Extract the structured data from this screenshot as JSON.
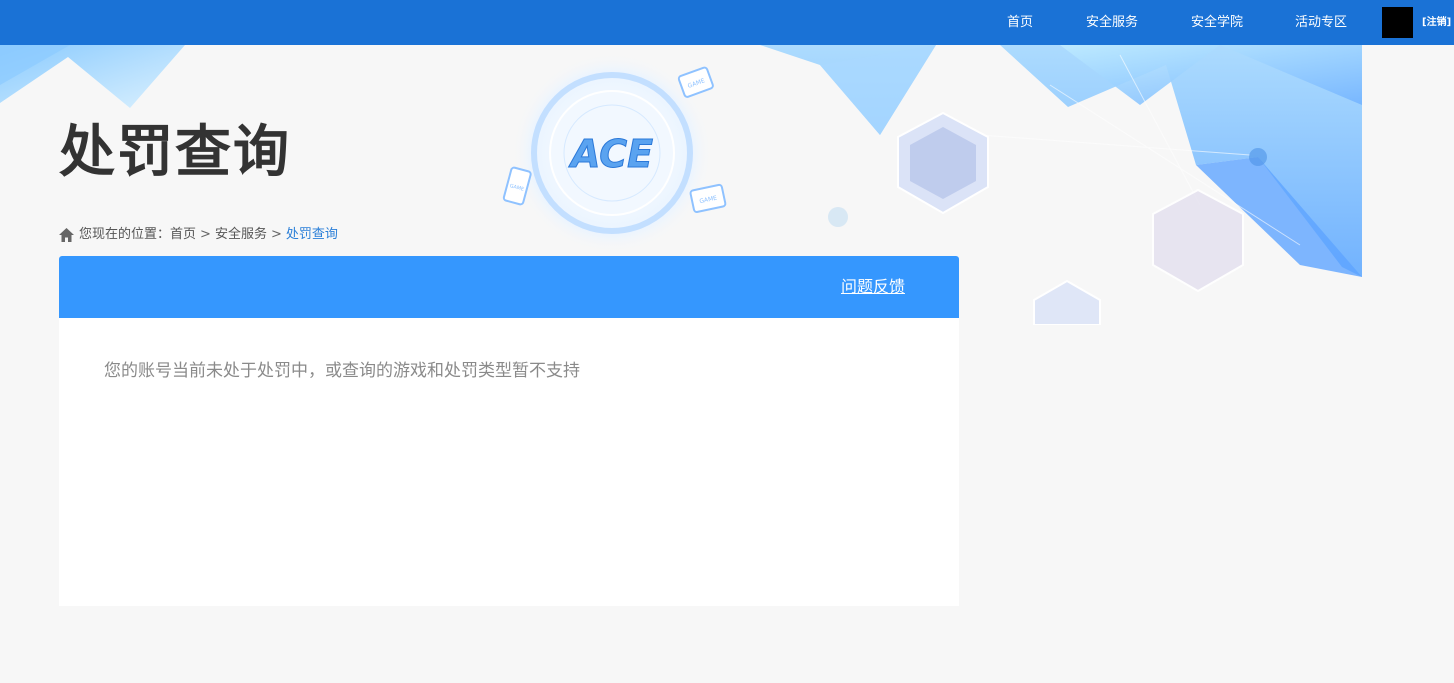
{
  "nav": {
    "items": [
      {
        "label": "首页"
      },
      {
        "label": "安全服务"
      },
      {
        "label": "安全学院"
      },
      {
        "label": "活动专区"
      }
    ],
    "logout_label": "[注销]"
  },
  "banner": {
    "logo_text": "ACE",
    "game_badge_text": "GAME"
  },
  "page": {
    "title": "处罚查询"
  },
  "breadcrumb": {
    "prefix": "您现在的位置：",
    "items": [
      "首页",
      "安全服务",
      "处罚查询"
    ],
    "separator": ">"
  },
  "panel": {
    "feedback_label": "问题反馈",
    "message": "您的账号当前未处于处罚中，或查询的游戏和处罚类型暂不支持"
  },
  "colors": {
    "topbar": "#1a72d6",
    "panel_header": "#3597fe",
    "breadcrumb_current": "#2b7fd8"
  }
}
